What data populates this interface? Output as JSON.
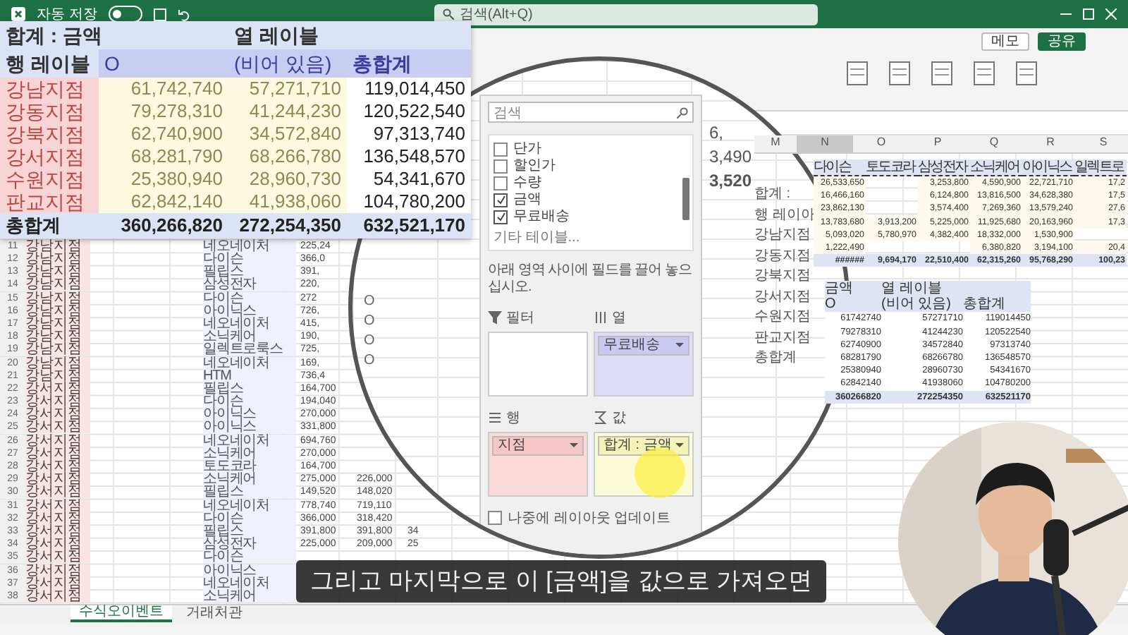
{
  "titlebar": {
    "autosave_label": "자동 저장",
    "autosave_on": false,
    "search_placeholder": "검색(Alt+Q)"
  },
  "ribbon": {
    "buttons": [
      "메모",
      "공유"
    ]
  },
  "columns": [
    {
      "label": "M",
      "selected": false
    },
    {
      "label": "N",
      "selected": true
    },
    {
      "label": "O",
      "selected": false
    },
    {
      "label": "P",
      "selected": false
    },
    {
      "label": "Q",
      "selected": false
    },
    {
      "label": "R",
      "selected": false
    },
    {
      "label": "S",
      "selected": false
    }
  ],
  "sheet_rows": [
    {
      "row": "11",
      "branch": "강남지점",
      "brand": "네오네이처",
      "price": "225,24"
    },
    {
      "row": "12",
      "branch": "강남지점",
      "brand": "다이슨",
      "price": "366,0"
    },
    {
      "row": "13",
      "branch": "강남지점",
      "brand": "필립스",
      "price": "391,"
    },
    {
      "row": "14",
      "branch": "강남지점",
      "brand": "삼성전자",
      "price": "220,"
    },
    {
      "row": "15",
      "branch": "강남지점",
      "brand": "다이슨",
      "price": "272"
    },
    {
      "row": "16",
      "branch": "강남지점",
      "brand": "아이닉스",
      "price": "726,"
    },
    {
      "row": "17",
      "branch": "강남지점",
      "brand": "네오네이처",
      "price": "415,"
    },
    {
      "row": "18",
      "branch": "강남지점",
      "brand": "소닉케어",
      "price": "190,"
    },
    {
      "row": "19",
      "branch": "강남지점",
      "brand": "일렉트로룩스",
      "price": "725,"
    },
    {
      "row": "20",
      "branch": "강남지점",
      "brand": "네오네이처",
      "price": "169,"
    },
    {
      "row": "21",
      "branch": "강남지점",
      "brand": "HTM",
      "price": "736,4"
    },
    {
      "row": "22",
      "branch": "강서지점",
      "brand": "필립스",
      "price": "164,700"
    },
    {
      "row": "23",
      "branch": "강서지점",
      "brand": "다이슨",
      "price": "194,040"
    },
    {
      "row": "24",
      "branch": "강서지점",
      "brand": "아이닉스",
      "price": "270,000"
    },
    {
      "row": "25",
      "branch": "강서지점",
      "brand": "아이닉스",
      "price": "331,800"
    },
    {
      "row": "26",
      "branch": "강서지점",
      "brand": "네오네이처",
      "price": "694,760"
    },
    {
      "row": "27",
      "branch": "강서지점",
      "brand": "소닉케어",
      "price": "270,000"
    },
    {
      "row": "28",
      "branch": "강서지점",
      "brand": "토도코라",
      "price": "164,700"
    },
    {
      "row": "29",
      "branch": "강서지점",
      "brand": "소닉케어",
      "price": "275,000",
      "sale": "226,000"
    },
    {
      "row": "30",
      "branch": "강서지점",
      "brand": "필립스",
      "price": "149,520",
      "sale": "148,020"
    },
    {
      "row": "31",
      "branch": "강서지점",
      "brand": "네오네이처",
      "price": "778,740",
      "sale": "719,110"
    },
    {
      "row": "32",
      "branch": "강서지점",
      "brand": "다이슨",
      "price": "366,000",
      "sale": "318,420"
    },
    {
      "row": "33",
      "branch": "강서지점",
      "brand": "필립스",
      "price": "391,800",
      "sale": "391,800",
      "qty": "34"
    },
    {
      "row": "34",
      "branch": "강서지점",
      "brand": "삼성전자",
      "price": "225,000",
      "sale": "209,000",
      "qty": "25"
    },
    {
      "row": "35",
      "branch": "강서지점",
      "brand": "다이슨"
    },
    {
      "row": "36",
      "branch": "강서지점",
      "brand": "아이닉스"
    },
    {
      "row": "37",
      "branch": "강서지점",
      "brand": "네오네이처"
    },
    {
      "row": "38",
      "branch": "강서지점",
      "brand": "소닉케어"
    }
  ],
  "sheet_tabs": [
    {
      "label": "수식오이벤트",
      "selected": true
    },
    {
      "label": "거래처관",
      "selected": false
    }
  ],
  "zoom_pivot": {
    "corner": "합계 : 금액",
    "column_label": "열 레이블",
    "row_label": "행 레이블",
    "headers": [
      "O",
      "(비어 있음)",
      "총합계"
    ],
    "rows": [
      {
        "label": "강남지점",
        "values": [
          "61,742,740",
          "57,271,710",
          "119,014,450"
        ]
      },
      {
        "label": "강동지점",
        "values": [
          "79,278,310",
          "41,244,230",
          "120,522,540"
        ]
      },
      {
        "label": "강북지점",
        "values": [
          "62,740,900",
          "34,572,840",
          "97,313,740"
        ]
      },
      {
        "label": "강서지점",
        "values": [
          "68,281,790",
          "68,266,780",
          "136,548,570"
        ]
      },
      {
        "label": "수원지점",
        "values": [
          "25,380,940",
          "28,960,730",
          "54,341,670"
        ]
      },
      {
        "label": "판교지점",
        "values": [
          "62,842,140",
          "41,938,060",
          "104,780,200"
        ]
      }
    ],
    "total": {
      "label": "총합계",
      "values": [
        "360,266,820",
        "272,254,350",
        "632,521,170"
      ]
    }
  },
  "circle_cells": [
    "6,",
    "3,490",
    "3,520"
  ],
  "circle_marks": [
    "O",
    "O",
    "O",
    "O"
  ],
  "field_list": {
    "search_placeholder": "검색",
    "fields": [
      {
        "label": "단가",
        "checked": false
      },
      {
        "label": "할인가",
        "checked": false
      },
      {
        "label": "수량",
        "checked": false
      },
      {
        "label": "금액",
        "checked": true
      },
      {
        "label": "무료배송",
        "checked": true
      }
    ],
    "more_tables": "기타 테이블...",
    "instruction": "아래 영역 사이에 필드를 끌어 놓으십시오.",
    "areas": [
      {
        "kind": "filter",
        "label": "필터"
      },
      {
        "kind": "columns",
        "label": "열",
        "item": "무료배송"
      },
      {
        "kind": "rows",
        "label": "행",
        "item": "지점"
      },
      {
        "kind": "values",
        "label": "값",
        "item": "합계 : 금액"
      }
    ],
    "defer_label": "나중에 레이아웃 업데이트",
    "defer_checked": false
  },
  "right_pivot": {
    "headers": [
      "다이슨",
      "토도코라",
      "삼성전자",
      "소닉케어",
      "아이닉스",
      "일렉트로"
    ],
    "rows": [
      [
        "26,533,650",
        null,
        "3,253,800",
        "4,590,900",
        "22,721,710",
        "17,2"
      ],
      [
        "16,466,160",
        null,
        "6,124,800",
        "13,816,500",
        "34,628,380",
        "17,5"
      ],
      [
        "23,862,130",
        null,
        "3,574,400",
        "7,269,360",
        "13,579,240",
        "27,6"
      ],
      [
        "13,783,680",
        "3,913,200",
        "5,225,000",
        "11,925,680",
        "20,163,960",
        "17,3"
      ],
      [
        "5,093,020",
        "5,780,970",
        "4,382,400",
        "18,332,000",
        "1,530,900",
        null
      ],
      [
        "1,222,490",
        null,
        null,
        "6,380,820",
        "3,194,100",
        "20,4"
      ]
    ],
    "total": [
      "######",
      "9,694,170",
      "22,510,400",
      "62,315,260",
      "95,768,290",
      "100,23"
    ]
  },
  "big_labels": [
    "합계 :",
    "행 레이아",
    "강남지점",
    "강동지점",
    "강북지점",
    "강서지점",
    "수원지점",
    "판교지점",
    "총합계"
  ],
  "small_pivot": {
    "corner": "금액",
    "column_label": "열 레이블",
    "headers": [
      "O",
      "(비어 있음)",
      "총합계"
    ],
    "rows": [
      [
        "61742740",
        "57271710",
        "119014450"
      ],
      [
        "79278310",
        "41244230",
        "120522540"
      ],
      [
        "62740900",
        "34572840",
        "97313740"
      ],
      [
        "68281790",
        "68266780",
        "136548570"
      ],
      [
        "25380940",
        "28960730",
        "54341670"
      ],
      [
        "62842140",
        "41938060",
        "104780200"
      ]
    ],
    "total": [
      "360266820",
      "272254350",
      "632521170"
    ]
  },
  "subtitle": "그리고 마지막으로 이 [금액]을 값으로 가져오면"
}
